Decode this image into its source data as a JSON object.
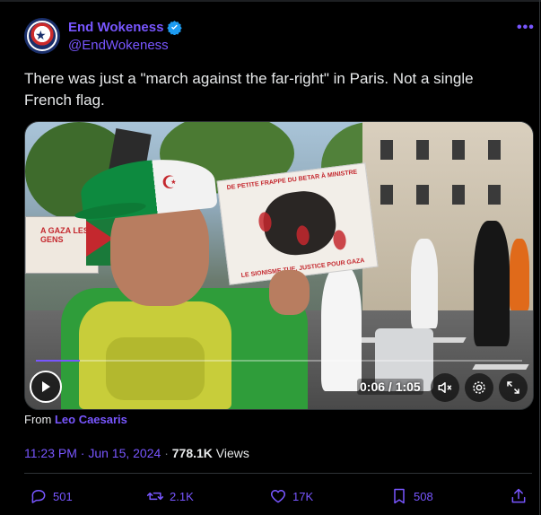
{
  "author": {
    "display_name": "End Wokeness",
    "handle": "@EndWokeness",
    "verified": true
  },
  "menu_label": "•••",
  "tweet": {
    "text": "There was just a \"march against the far-right\" in Paris. Not a single French flag."
  },
  "media": {
    "type": "video",
    "sign_top_text": "DE PETITE FRAPPE DU BETAR À MINISTRE",
    "sign_bottom_text": "LE SIONISME TUE, JUSTICE POUR GAZA",
    "left_sign_text": "A GAZA LES GENS",
    "current_time": "0:06 / 1:05",
    "progress_fraction": 0.09,
    "controls": [
      "play-icon",
      "volume-icon",
      "settings-icon",
      "fullscreen-icon"
    ]
  },
  "attribution": {
    "prefix": "From",
    "source": "Leo Caesaris"
  },
  "meta": {
    "time": "11:23 PM · Jun 15, 2024",
    "separator": "·",
    "views_count": "778.1K",
    "views_label": "Views"
  },
  "actions": {
    "replies": "501",
    "reposts": "2.1K",
    "likes": "17K",
    "bookmarks": "508"
  },
  "colors": {
    "accent": "#7856ff",
    "background": "#000000",
    "text": "#e7e9ea",
    "muted": "#71767b"
  }
}
